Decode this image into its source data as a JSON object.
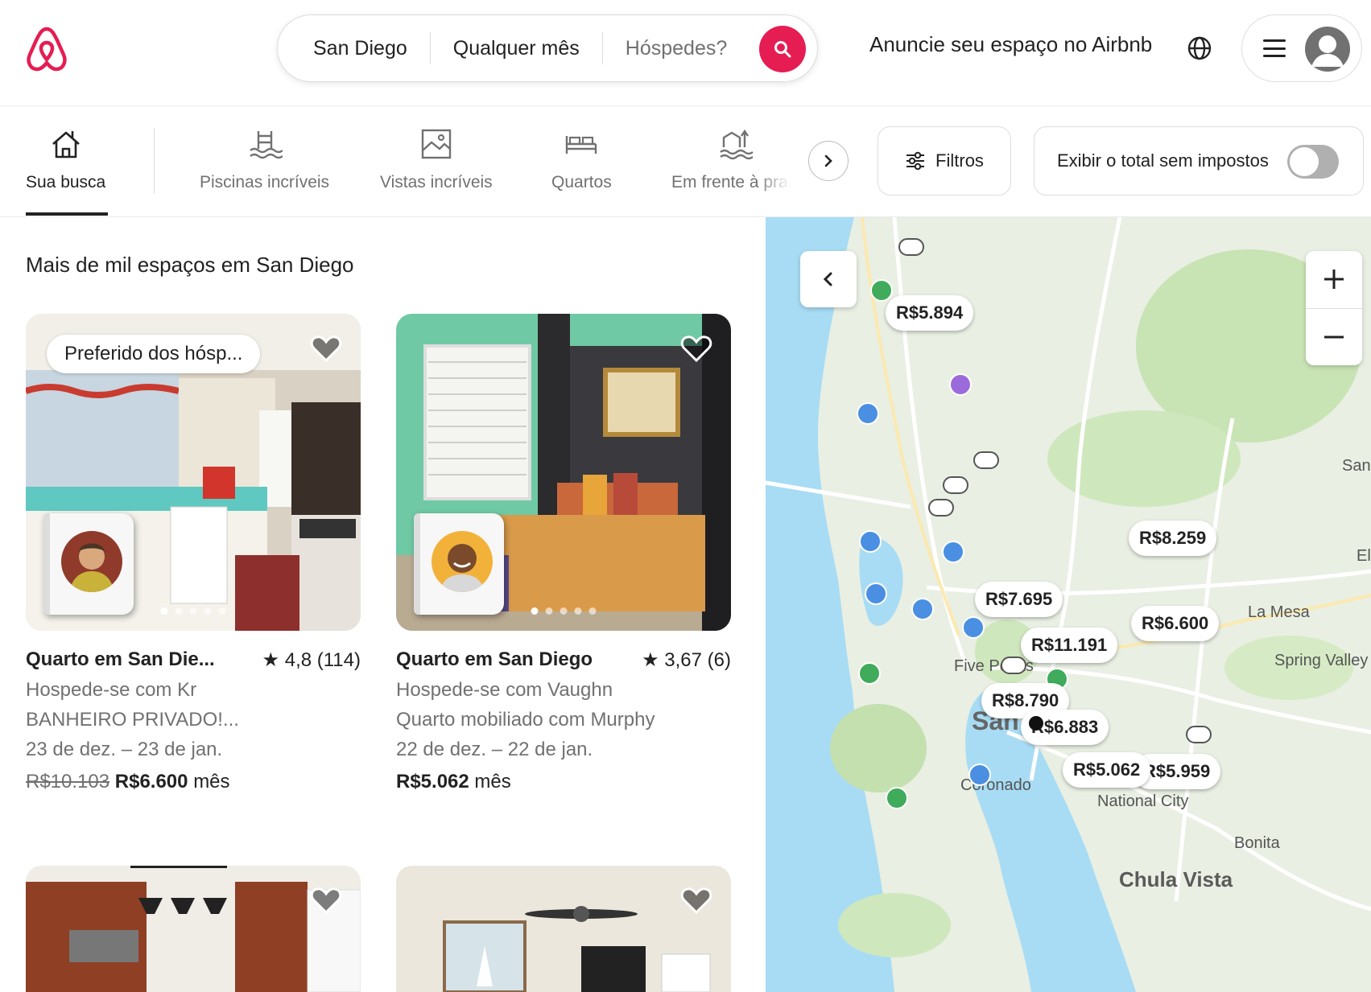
{
  "header": {
    "search": {
      "location": "San Diego",
      "dates": "Qualquer mês",
      "guests_placeholder": "Hóspedes?"
    },
    "host_link": "Anuncie seu espaço no Airbnb"
  },
  "categories": [
    {
      "label": "Sua busca",
      "icon": "house-icon"
    },
    {
      "label": "Piscinas incríveis",
      "icon": "pool-icon"
    },
    {
      "label": "Vistas incríveis",
      "icon": "view-icon"
    },
    {
      "label": "Quartos",
      "icon": "bed-icon"
    },
    {
      "label": "Em frente à praia",
      "icon": "beach-icon"
    }
  ],
  "filters_label": "Filtros",
  "tax_toggle_label": "Exibir o total sem impostos",
  "results_count": "Mais de mil espaços em San Diego",
  "listings": [
    {
      "badge": "Preferido dos hósp...",
      "title": "Quarto em San Die...",
      "rating": "★ 4,8 (114)",
      "host": "Hospede-se com Kr",
      "description": "BANHEIRO PRIVADO!...",
      "dates": "23 de dez. – 23 de jan.",
      "price_old": "R$10.103",
      "price": "R$6.600",
      "price_unit": "mês"
    },
    {
      "badge": "",
      "title": "Quarto em San Diego",
      "rating": "★ 3,67 (6)",
      "host": "Hospede-se com Vaughn",
      "description": "Quarto mobiliado com Murphy",
      "dates": "22 de dez. – 22 de jan.",
      "price_old": "",
      "price": "R$5.062",
      "price_unit": "mês"
    }
  ],
  "map": {
    "price_pins": [
      "R$5.894",
      "R$8.259",
      "R$7.695",
      "R$6.600",
      "R$11.191",
      "R$8.790",
      "R$6.883",
      "R$5.062",
      "R$5.959"
    ],
    "places": [
      "Five Points",
      "La Mesa",
      "Spring Valley",
      "Coronado",
      "National City",
      "Bonita",
      "Chula Vista",
      "San",
      "El",
      "San"
    ]
  },
  "colors": {
    "brand": "#e51d53",
    "water": "#a8dcf4",
    "park": "#c8e3b4"
  }
}
